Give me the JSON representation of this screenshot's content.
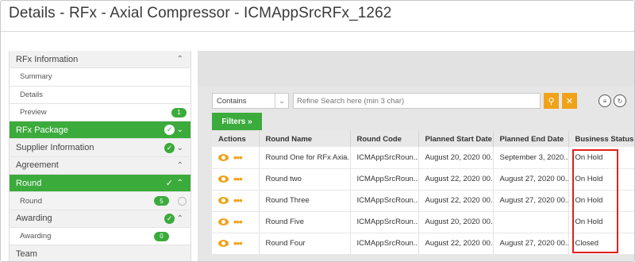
{
  "page": {
    "title": "Details - RFx - Axial Compressor - ICMAppSrcRFx_1262"
  },
  "sidebar": {
    "items": [
      {
        "label": "RFx Information",
        "kind": "section",
        "chevron": "up"
      },
      {
        "label": "Summary",
        "kind": "sub"
      },
      {
        "label": "Details",
        "kind": "sub"
      },
      {
        "label": "Preview",
        "kind": "sub",
        "count": "1"
      },
      {
        "label": "RFx Package",
        "kind": "active",
        "chevron": "down",
        "check": true
      },
      {
        "label": "Supplier Information",
        "kind": "section",
        "chevron": "down",
        "check": true
      },
      {
        "label": "Agreement",
        "kind": "section",
        "chevron": "up"
      },
      {
        "label": "Round",
        "kind": "active",
        "chevron": "up",
        "check": true
      },
      {
        "label": "Round",
        "kind": "sub",
        "count": "5"
      },
      {
        "label": "Awarding",
        "kind": "section",
        "chevron": "up",
        "check": true
      },
      {
        "label": "Awarding",
        "kind": "sub",
        "count": "0"
      },
      {
        "label": "Team",
        "kind": "section"
      }
    ]
  },
  "search": {
    "filter_value": "Contains",
    "placeholder": "Refine Search here (min 3 char)",
    "filters_label": "Filters »",
    "search_glyph": "⚲",
    "clear_glyph": "✕"
  },
  "table": {
    "columns": [
      "Actions",
      "Round Name",
      "Round Code",
      "Planned Start Date",
      "Planned End Date",
      "Business Status"
    ],
    "rows": [
      {
        "name": "Round One for RFx Axia...",
        "code": "ICMAppSrcRoun...",
        "start": "August 20, 2020 00...",
        "end": "September 3, 2020...",
        "status": "On Hold"
      },
      {
        "name": "Round two",
        "code": "ICMAppSrcRoun...",
        "start": "August 22, 2020 00...",
        "end": "August 27, 2020 00...",
        "status": "On Hold"
      },
      {
        "name": "Round Three",
        "code": "ICMAppSrcRoun...",
        "start": "August 22, 2020 00...",
        "end": "August 27, 2020 00...",
        "status": "On Hold"
      },
      {
        "name": "Round Five",
        "code": "ICMAppSrcRoun...",
        "start": "August 20, 2020 00...",
        "end": "",
        "status": "On Hold"
      },
      {
        "name": "Round Four",
        "code": "ICMAppSrcRoun...",
        "start": "August 22, 2020 00...",
        "end": "August 27, 2020 00...",
        "status": "Closed"
      }
    ]
  },
  "colors": {
    "accent_green": "#3bab3c",
    "accent_orange": "#f0a21a",
    "highlight_red": "#e0201c"
  }
}
